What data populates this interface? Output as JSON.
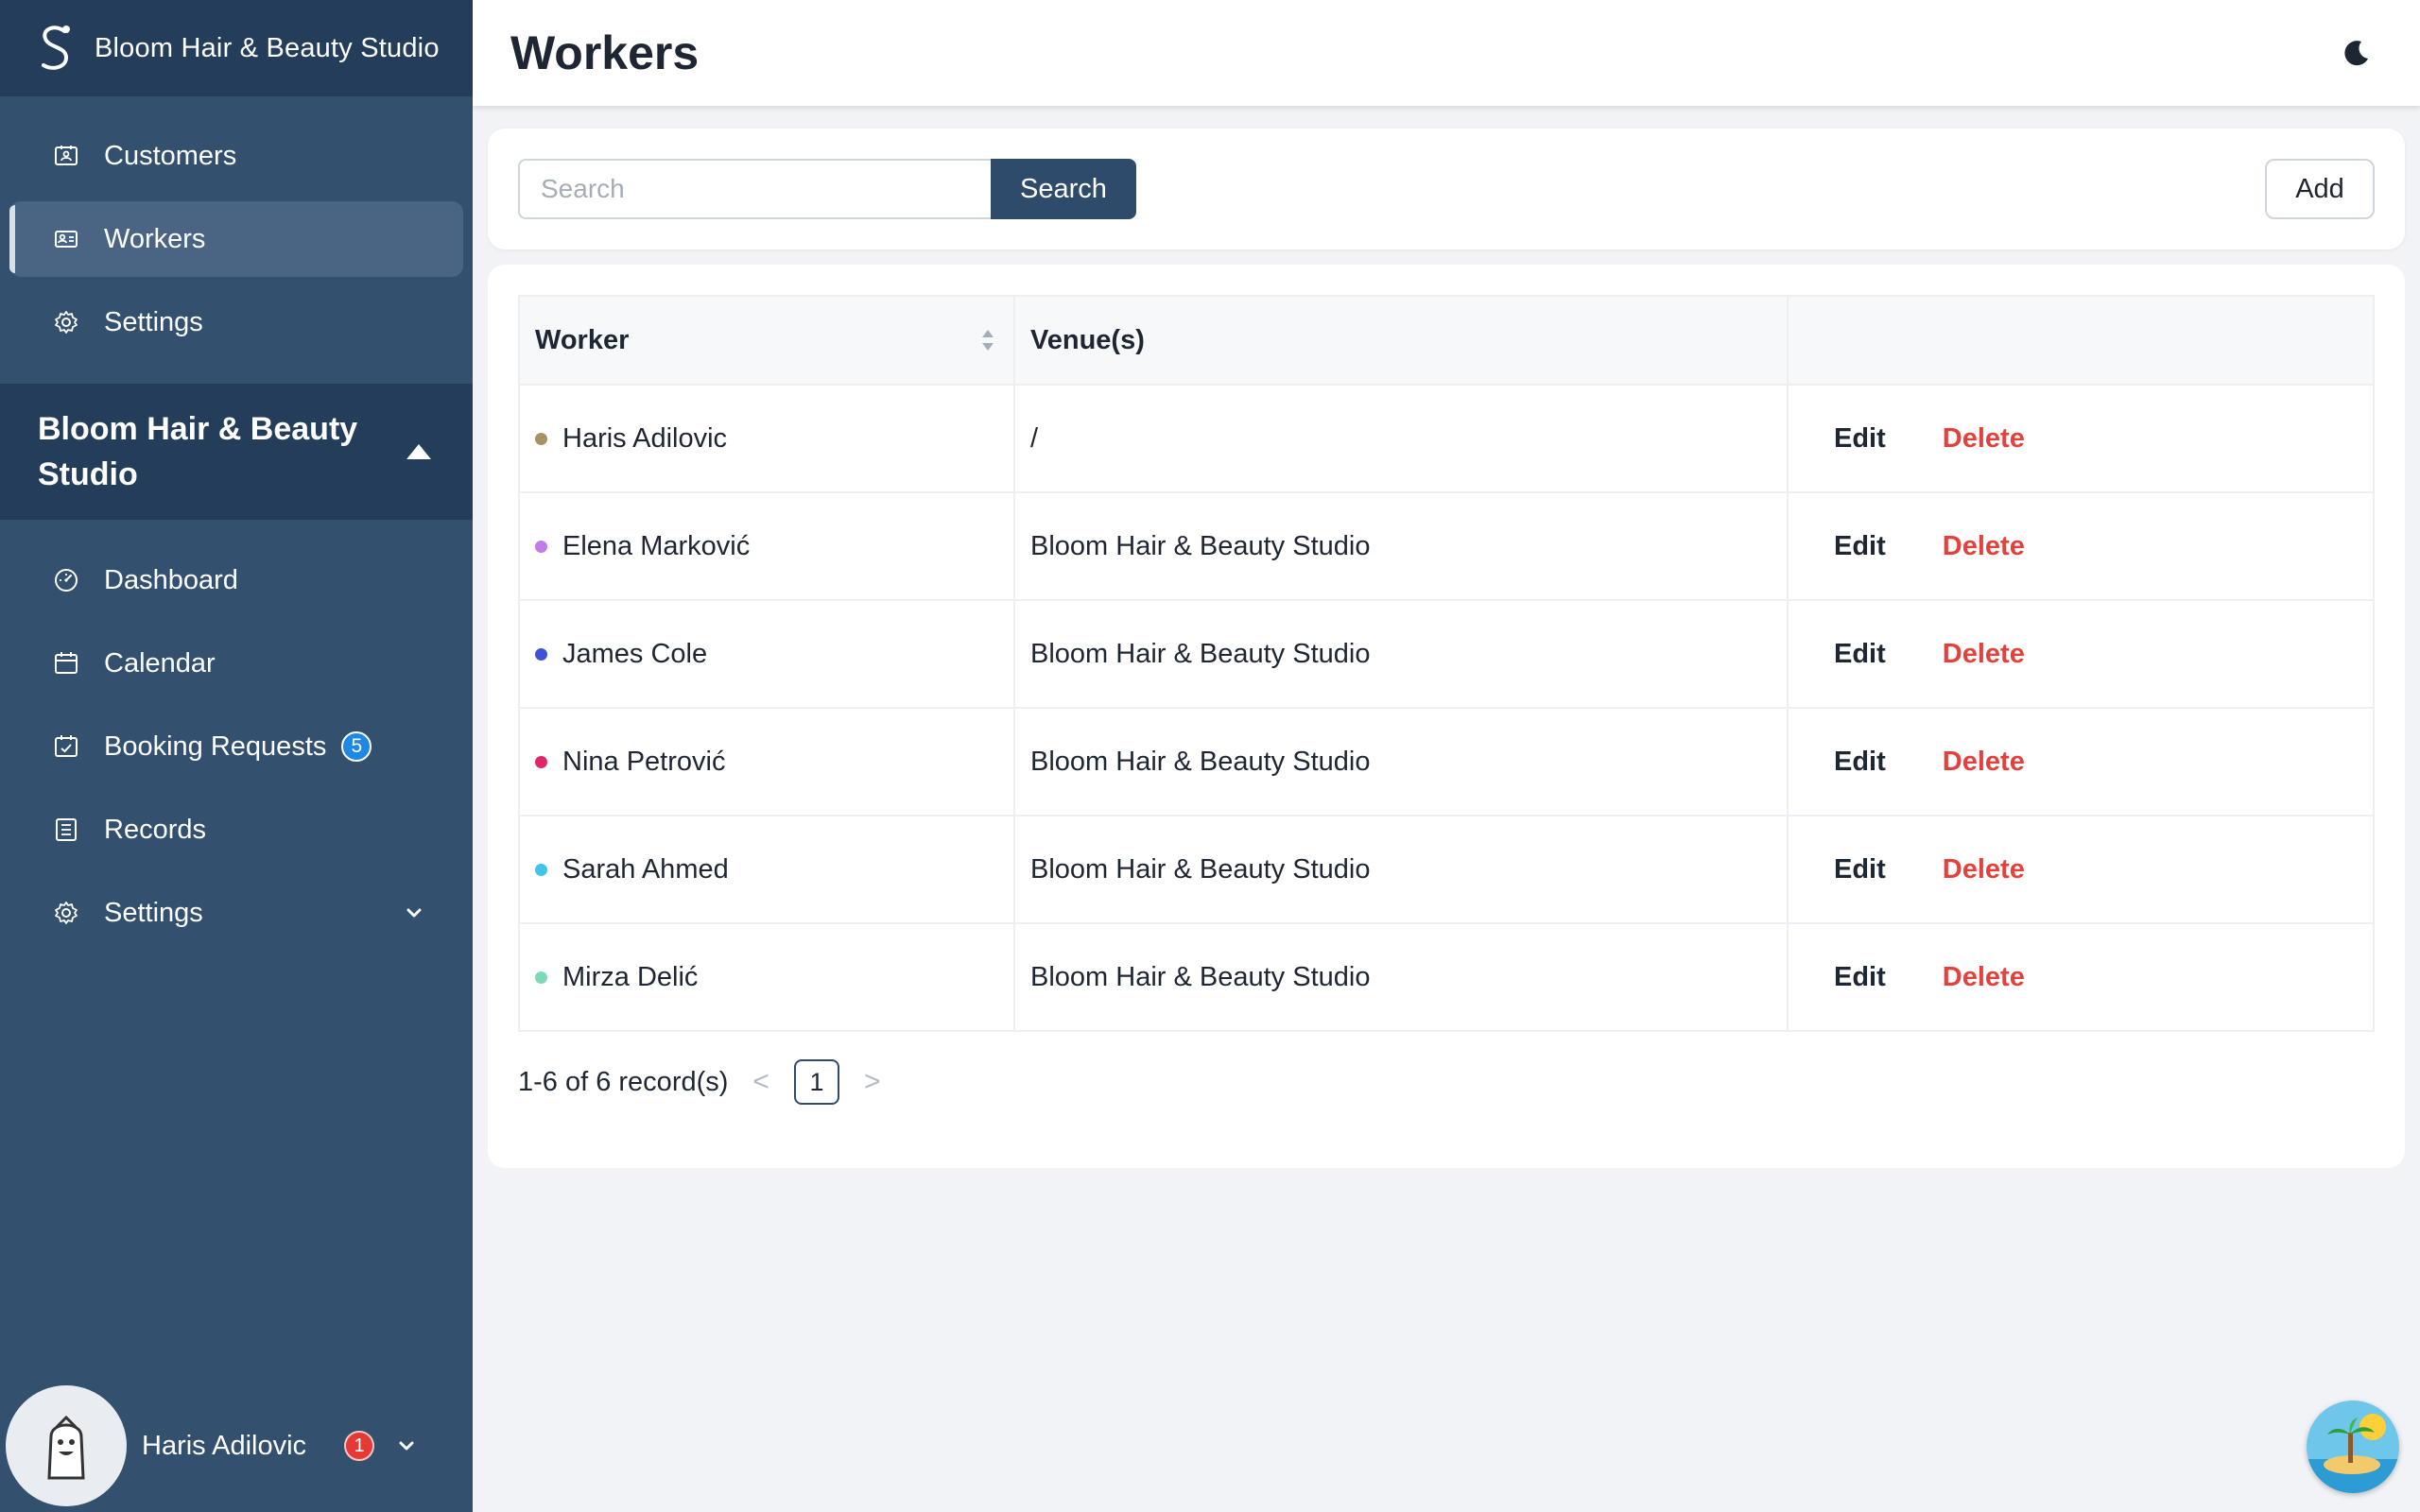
{
  "brand": {
    "name": "Bloom Hair & Beauty Studio"
  },
  "sidebar": {
    "top_items": [
      {
        "label": "Customers",
        "icon": "customers-icon"
      },
      {
        "label": "Workers",
        "icon": "workers-icon",
        "active": true
      },
      {
        "label": "Settings",
        "icon": "gear-icon"
      }
    ],
    "group_title": "Bloom Hair & Beauty Studio",
    "group_items": [
      {
        "label": "Dashboard",
        "icon": "dashboard-icon"
      },
      {
        "label": "Calendar",
        "icon": "calendar-icon"
      },
      {
        "label": "Booking Requests",
        "icon": "booking-icon",
        "badge": "5"
      },
      {
        "label": "Records",
        "icon": "records-icon"
      },
      {
        "label": "Settings",
        "icon": "gear-icon"
      }
    ],
    "user": {
      "name": "Haris Adilovic",
      "notifications": "1"
    }
  },
  "header": {
    "title": "Workers"
  },
  "search": {
    "placeholder": "Search",
    "button_label": "Search",
    "add_label": "Add"
  },
  "table": {
    "columns": [
      "Worker",
      "Venue(s)",
      ""
    ],
    "edit_label": "Edit",
    "delete_label": "Delete",
    "rows": [
      {
        "name": "Haris Adilovic",
        "venue": "/",
        "color": "#a89263"
      },
      {
        "name": "Elena Marković",
        "venue": "Bloom Hair & Beauty Studio",
        "color": "#c37be8"
      },
      {
        "name": "James Cole",
        "venue": "Bloom Hair & Beauty Studio",
        "color": "#3f51d6"
      },
      {
        "name": "Nina Petrović",
        "venue": "Bloom Hair & Beauty Studio",
        "color": "#e0266b"
      },
      {
        "name": "Sarah Ahmed",
        "venue": "Bloom Hair & Beauty Studio",
        "color": "#40c4ea"
      },
      {
        "name": "Mirza Delić",
        "venue": "Bloom Hair & Beauty Studio",
        "color": "#7fd8b8"
      }
    ]
  },
  "pagination": {
    "summary": "1-6 of 6 record(s)",
    "current_page": "1",
    "prev": "<",
    "next": ">"
  },
  "colors": {
    "sidebar": "#33506f",
    "sidebar_dark": "#243d5a",
    "primary": "#2f4b6c",
    "danger": "#e5413c"
  }
}
